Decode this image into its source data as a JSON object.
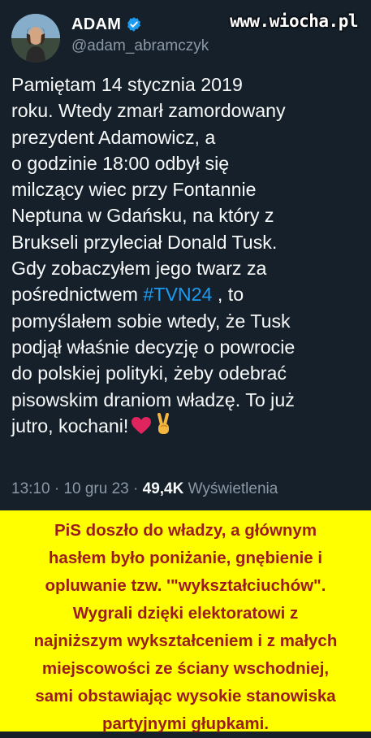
{
  "watermark": "www.wiocha.pl",
  "author": {
    "display_name": "ADAM",
    "handle": "@adam_abramczyk",
    "verified_color": "#1d9bf0"
  },
  "tweet": {
    "lines": [
      [
        {
          "text": "Pamiętam 14 stycznia 2019"
        }
      ],
      [
        {
          "text": "roku. Wtedy zmarł zamordowany"
        }
      ],
      [
        {
          "text": "prezydent Adamowicz, a"
        }
      ],
      [
        {
          "text": "o godzinie 18:00 odbył się"
        }
      ],
      [
        {
          "text": "milczący wiec przy Fontannie"
        }
      ],
      [
        {
          "text": "Neptuna w Gdańsku, na który z"
        }
      ],
      [
        {
          "text": "Brukseli przyleciał Donald Tusk."
        }
      ],
      [
        {
          "text": "Gdy zobaczyłem jego twarz za"
        }
      ],
      [
        {
          "text": "pośrednictwem "
        },
        {
          "text": "#TVN24",
          "hashtag": true
        },
        {
          "text": " , to"
        }
      ],
      [
        {
          "text": "pomyślałem sobie wtedy, że Tusk"
        }
      ],
      [
        {
          "text": "podjął właśnie decyzję o powrocie"
        }
      ],
      [
        {
          "text": "do polskiej polityki, żeby odebrać"
        }
      ],
      [
        {
          "text": "pisowskim draniom władzę. To już"
        }
      ],
      [
        {
          "text": "jutro, kochani!"
        },
        {
          "emoji": "heart-icon"
        },
        {
          "emoji": "victory-hand-icon"
        }
      ]
    ],
    "time": "13:10",
    "separator": " · ",
    "date": "10 gru 23",
    "views_count": "49,4K",
    "views_label": " Wyświetlenia"
  },
  "caption": {
    "background": "#ffff00",
    "text_color": "#9b1c1c",
    "lines": [
      "PiS doszło do władzy, a głównym",
      "hasłem było poniżanie, gnębienie i",
      "opluwanie tzw. '\"wykształciuchów\".",
      "Wygrali dzięki elektoratowi z",
      "najniższym wykształceniem i z małych",
      "miejscowości ze ściany wschodniej,",
      "sami obstawiając wysokie stanowiska",
      "partyjnymi głupkami."
    ]
  }
}
